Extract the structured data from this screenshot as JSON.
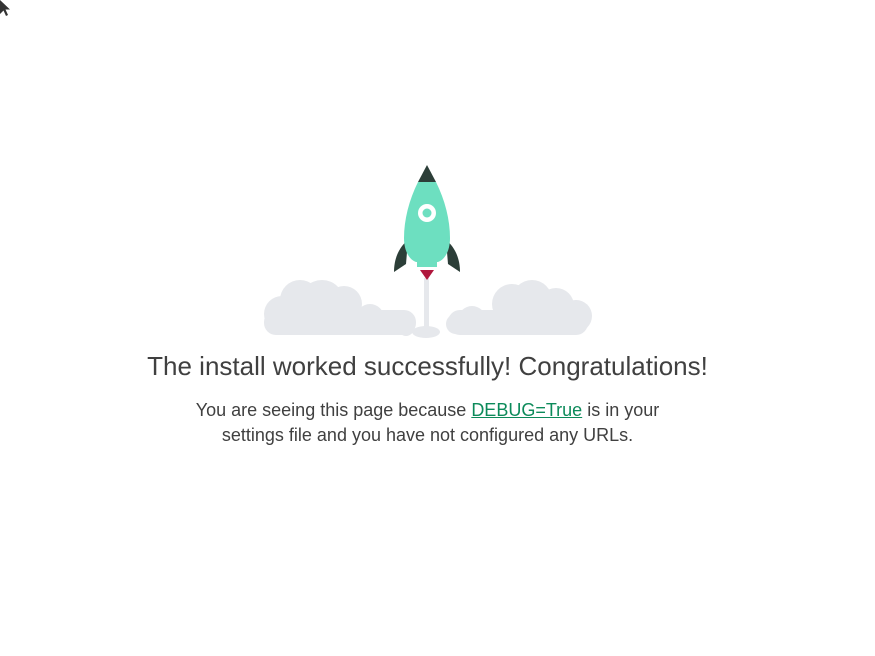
{
  "page": {
    "title": "The install worked successfully! Congratulations!",
    "message_before_link": "You are seeing this page because ",
    "debug_link": "DEBUG=True",
    "message_after_link": " is in your",
    "message_line2": "settings file and you have not configured any URLs."
  },
  "colors": {
    "rocket_body": "#6ddfc0",
    "rocket_dark": "#2c3e38",
    "flame": "#b0173d",
    "cloud": "#e6e8ec",
    "link": "#0c8a5a",
    "text": "#404040"
  },
  "icons": {
    "cursor": "mouse-pointer-icon",
    "hero": "rocket-launch-illustration"
  }
}
